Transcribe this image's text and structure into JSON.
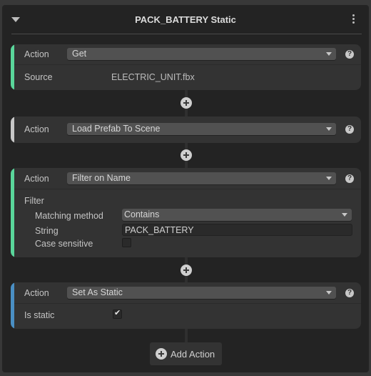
{
  "header": {
    "title": "PACK_BATTERY Static",
    "collapse_icon": "triangle-down",
    "menu_icon": "vertical-ellipsis"
  },
  "cards": [
    {
      "accent_color": "#5ad69b",
      "action_label": "Action",
      "action_value": "Get",
      "help": "?",
      "fields": {
        "source_label": "Source",
        "source_value": "ELECTRIC_UNIT.fbx"
      }
    },
    {
      "accent_color": "#c8c8c8",
      "action_label": "Action",
      "action_value": "Load Prefab To Scene",
      "help": "?"
    },
    {
      "accent_color": "#5ad69b",
      "action_label": "Action",
      "action_value": "Filter on Name",
      "help": "?",
      "fields": {
        "filter_label": "Filter",
        "matching_method_label": "Matching method",
        "matching_method_value": "Contains",
        "string_label": "String",
        "string_value": "PACK_BATTERY",
        "case_sensitive_label": "Case sensitive",
        "case_sensitive_checked": false
      }
    },
    {
      "accent_color": "#4a8fc4",
      "action_label": "Action",
      "action_value": "Set As Static",
      "help": "?",
      "fields": {
        "is_static_label": "Is static",
        "is_static_checked": true,
        "check_glyph": "✔"
      }
    }
  ],
  "add_action": {
    "label": "Add Action"
  }
}
